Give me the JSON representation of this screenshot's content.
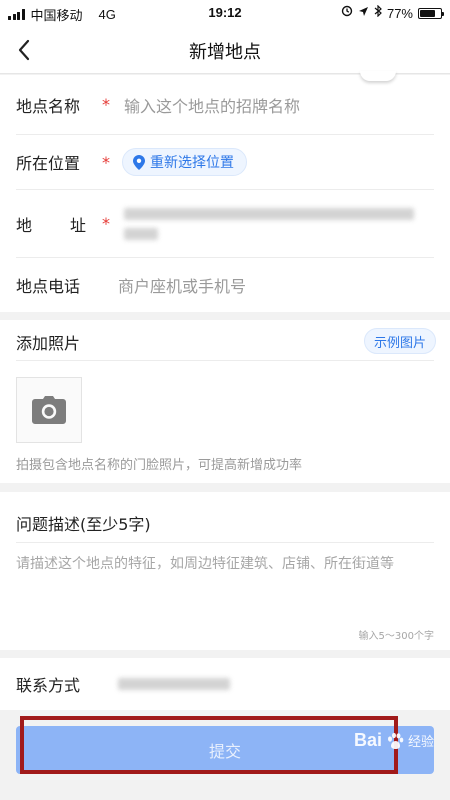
{
  "status_bar": {
    "carrier": "中国移动",
    "network": "4G",
    "time": "19:12",
    "battery": "77%",
    "battery_level": 0.77
  },
  "nav": {
    "title": "新增地点",
    "back_icon": "chevron-left-icon"
  },
  "form": {
    "name_label": "地点名称",
    "name_placeholder": "输入这个地点的招牌名称",
    "location_label": "所在位置",
    "location_button": "重新选择位置",
    "address_label_chars": [
      "地",
      "址"
    ],
    "phone_label": "地点电话",
    "phone_placeholder": "商户座机或手机号",
    "required_mark": "*"
  },
  "photo": {
    "title": "添加照片",
    "example_button": "示例图片",
    "hint": "拍摄包含地点名称的门脸照片，可提高新增成功率"
  },
  "description": {
    "title": "问题描述(至少5字)",
    "placeholder": "请描述这个地点的特征，如周边特征建筑、店铺、所在街道等",
    "counter": "输入5～300个字"
  },
  "contact": {
    "label": "联系方式"
  },
  "submit": {
    "label": "提交"
  },
  "watermark": {
    "text": "Bai",
    "sub": "经验"
  },
  "colors": {
    "accent": "#2e78e8",
    "required": "#e53935",
    "submit_bg": "#8db4f6",
    "highlight_border": "#a11a1a"
  }
}
